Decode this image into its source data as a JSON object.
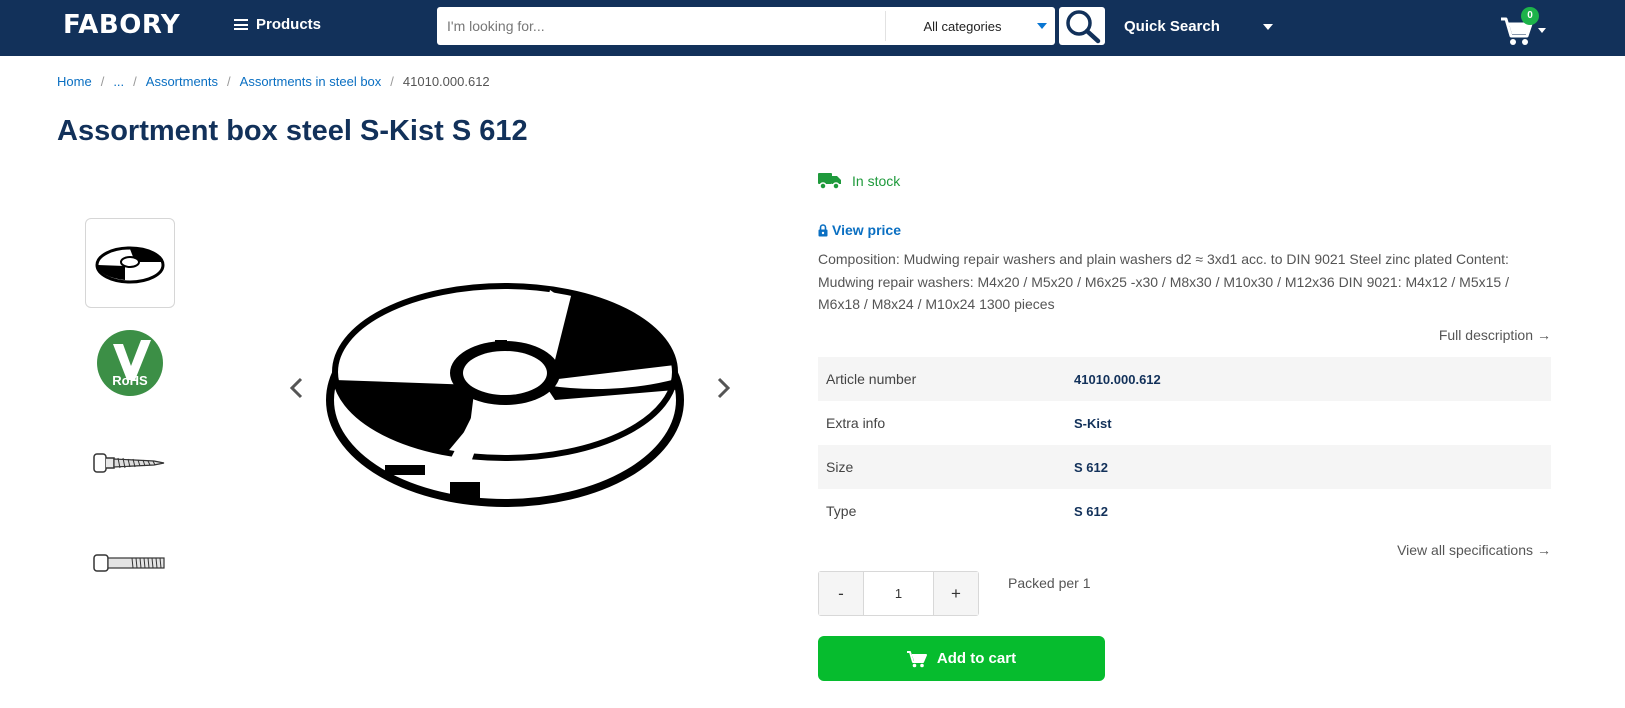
{
  "header": {
    "logo": "FABORY",
    "products_label": "Products",
    "search_placeholder": "I'm looking for...",
    "category_selected": "All categories",
    "quick_search_label": "Quick Search",
    "cart_count": "0",
    "bg_color": "#12315a"
  },
  "breadcrumb": [
    {
      "label": "Home"
    },
    {
      "label": "..."
    },
    {
      "label": "Assortments"
    },
    {
      "label": "Assortments in steel box"
    },
    {
      "label": "41010.000.612"
    }
  ],
  "product": {
    "title": "Assortment box steel S-Kist S 612",
    "stock_status": "In stock",
    "view_price_label": "View price",
    "composition": "Composition: Mudwing repair washers and plain washers d2 ≈ 3xd1 acc. to DIN 9021 Steel zinc plated Content: Mudwing repair washers: M4x20 / M5x20 / M6x25 -x30 / M8x30 / M10x30 / M12x36 DIN 9021: M4x12 / M5x15 / M6x18 / M8x24 / M10x24 1300 pieces",
    "full_description_label": "Full description",
    "specs": [
      {
        "key": "Article number",
        "value": "41010.000.612"
      },
      {
        "key": "Extra info",
        "value": "S-Kist"
      },
      {
        "key": "Size",
        "value": "S 612"
      },
      {
        "key": "Type",
        "value": "S 612"
      }
    ],
    "view_all_specs_label": "View all specifications",
    "quantity": "1",
    "qty_minus": "-",
    "qty_plus": "+",
    "packed_per": "Packed per 1",
    "add_to_cart_label": "Add to cart",
    "rohs_text": "RoHS",
    "accent_color": "#06bc2e",
    "link_color": "#0a6fc2"
  },
  "icons": {
    "menu": "hamburger-icon",
    "search": "search-icon",
    "cart": "cart-icon",
    "truck": "truck-icon",
    "lock": "lock-icon",
    "prev": "chevron-left-icon",
    "next": "chevron-right-icon",
    "arrow": "arrow-right-icon"
  }
}
